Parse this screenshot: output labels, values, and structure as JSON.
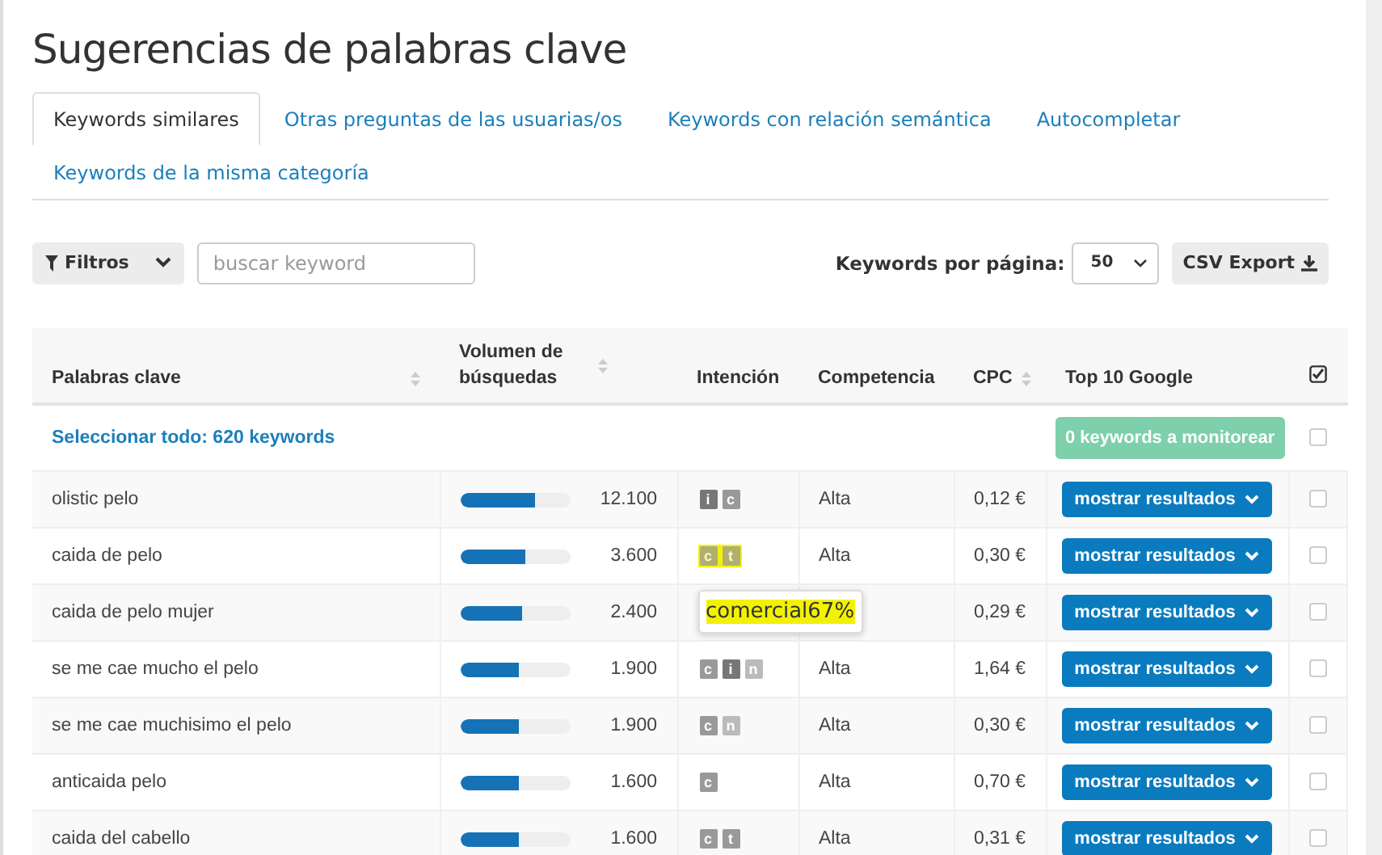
{
  "title": "Sugerencias de palabras clave",
  "tabs": [
    {
      "label": "Keywords similares",
      "selected": true
    },
    {
      "label": "Otras preguntas de las usuarias/os",
      "selected": false
    },
    {
      "label": "Keywords con relación semántica",
      "selected": false
    },
    {
      "label": "Autocompletar",
      "selected": false
    },
    {
      "label": "Keywords de la misma categoría",
      "selected": false
    }
  ],
  "toolbar": {
    "filter_button": "Filtros",
    "search": {
      "placeholder": "buscar keyword"
    },
    "per_page_label": "Keywords por página:",
    "per_page_value": "50",
    "export_button": "CSV Export"
  },
  "table": {
    "columns": [
      {
        "label": "Palabras clave",
        "sortable": true
      },
      {
        "label": "Volumen de búsquedas",
        "sortable": true
      },
      {
        "label": "Intención",
        "sortable": false
      },
      {
        "label": "Competencia",
        "sortable": false
      },
      {
        "label": "CPC",
        "sortable": true
      },
      {
        "label": "Top 10 Google",
        "sortable": false
      }
    ],
    "select_all": "Seleccionar todo: 620 keywords",
    "monitor_button": "0 keywords a monitorear",
    "select_all_checked": false,
    "rows": [
      {
        "keyword": "olistic pelo",
        "level": 0.68,
        "volume": "12.100",
        "intents": [
          {
            "letter": "i",
            "kind": "informational"
          },
          {
            "letter": "c",
            "kind": "commercial"
          }
        ],
        "highlighted": false,
        "competition": "Alta",
        "cpc": "0,12 €",
        "button": "mostrar resultados",
        "checked": false
      },
      {
        "keyword": "caida de pelo",
        "level": 0.6,
        "volume": "3.600",
        "intents": [
          {
            "letter": "c",
            "kind": "commercial"
          },
          {
            "letter": "t",
            "kind": "transactional"
          }
        ],
        "highlighted": true,
        "competition": "Alta",
        "cpc": "0,30 €",
        "button": "mostrar resultados",
        "checked": false
      },
      {
        "keyword": "caida de pelo mujer",
        "level": 0.56,
        "volume": "2.400",
        "intents": [],
        "highlighted": false,
        "tooltip": {
          "text": "comercial67%",
          "highlighted": true
        },
        "cpc": "0,29 €",
        "button": "mostrar resultados",
        "checked": false
      },
      {
        "keyword": "se me cae mucho el pelo",
        "level": 0.54,
        "volume": "1.900",
        "intents": [
          {
            "letter": "c",
            "kind": "commercial"
          },
          {
            "letter": "i",
            "kind": "informational"
          },
          {
            "letter": "n",
            "kind": "navigational"
          }
        ],
        "highlighted": false,
        "competition": "Alta",
        "cpc": "1,64 €",
        "button": "mostrar resultados",
        "checked": false
      },
      {
        "keyword": "se me cae muchisimo el pelo",
        "level": 0.54,
        "volume": "1.900",
        "intents": [
          {
            "letter": "c",
            "kind": "commercial"
          },
          {
            "letter": "n",
            "kind": "navigational"
          }
        ],
        "highlighted": false,
        "competition": "Alta",
        "cpc": "0,30 €",
        "button": "mostrar resultados",
        "checked": false
      },
      {
        "keyword": "anticaida pelo",
        "level": 0.53,
        "volume": "1.600",
        "intents": [
          {
            "letter": "c",
            "kind": "commercial"
          }
        ],
        "highlighted": false,
        "competition": "Alta",
        "cpc": "0,70 €",
        "button": "mostrar resultados",
        "checked": false
      },
      {
        "keyword": "caida del cabello",
        "level": 0.53,
        "volume": "1.600",
        "intents": [
          {
            "letter": "c",
            "kind": "commercial"
          },
          {
            "letter": "t",
            "kind": "transactional"
          }
        ],
        "highlighted": false,
        "competition": "Alta",
        "cpc": "0,31 €",
        "button": "mostrar resultados",
        "checked": false
      }
    ]
  }
}
